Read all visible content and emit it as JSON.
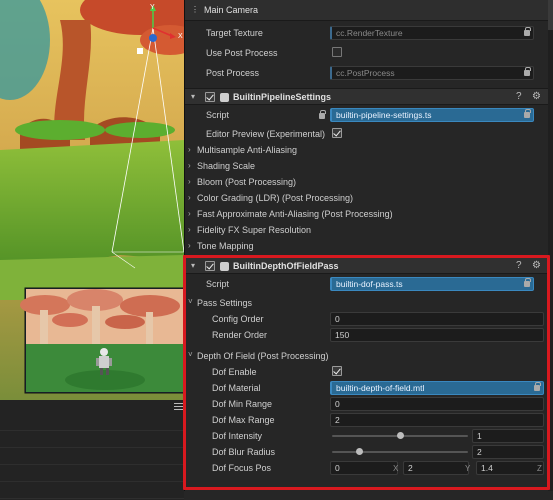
{
  "scene": {
    "gizmo_axis_y": "Y",
    "gizmo_axis_x": "X"
  },
  "inspector": {
    "camera_component": {
      "title": "Main Camera",
      "target_texture_label": "Target Texture",
      "target_texture_value": "cc.RenderTexture",
      "use_post_process_label": "Use Post Process",
      "use_post_process_checked": false,
      "post_process_label": "Post Process",
      "post_process_value": "cc.PostProcess"
    },
    "pipeline_settings": {
      "title": "BuiltinPipelineSettings",
      "enabled": true,
      "script_label": "Script",
      "script_value": "builtin-pipeline-settings.ts",
      "editor_preview_label": "Editor Preview (Experimental)",
      "editor_preview_checked": true,
      "sections": [
        "Multisample Anti-Aliasing",
        "Shading Scale",
        "Bloom (Post Processing)",
        "Color Grading (LDR) (Post Processing)",
        "Fast Approximate Anti-Aliasing (Post Processing)",
        "Fidelity FX Super Resolution",
        "Tone Mapping"
      ]
    },
    "dof_pass": {
      "title": "BuiltinDepthOfFieldPass",
      "enabled": true,
      "script_label": "Script",
      "script_value": "builtin-dof-pass.ts",
      "pass_settings_label": "Pass Settings",
      "config_order_label": "Config Order",
      "config_order_value": "0",
      "render_order_label": "Render Order",
      "render_order_value": "150",
      "dof_section_label": "Depth Of Field (Post Processing)",
      "dof_enable_label": "Dof Enable",
      "dof_enable_checked": true,
      "dof_material_label": "Dof Material",
      "dof_material_value": "builtin-depth-of-field.mtl",
      "dof_min_range_label": "Dof Min Range",
      "dof_min_range_value": "0",
      "dof_max_range_label": "Dof Max Range",
      "dof_max_range_value": "2",
      "dof_intensity_label": "Dof Intensity",
      "dof_intensity_value": "1",
      "dof_intensity_slider_fraction": 0.5,
      "dof_blur_radius_label": "Dof Blur Radius",
      "dof_blur_radius_value": "2",
      "dof_blur_radius_slider_fraction": 0.2,
      "dof_focus_pos_label": "Dof Focus Pos",
      "dof_focus_pos_x": "0",
      "dof_focus_pos_y": "2",
      "dof_focus_pos_z": "1.4",
      "axis_x": "X",
      "axis_y": "Y",
      "axis_z": "Z"
    }
  },
  "colors": {
    "highlight_border": "#d8191f",
    "asset_field_blue": "#2a6a94",
    "panel_bg": "#262626"
  }
}
